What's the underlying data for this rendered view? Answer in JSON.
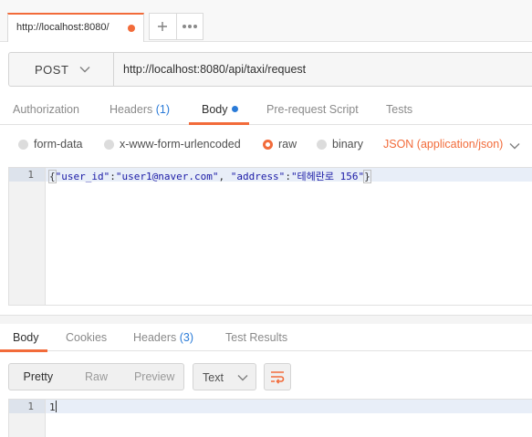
{
  "tab": {
    "title": "http://localhost:8080/",
    "unsaved_color": "#f26b3a"
  },
  "tab_actions": {
    "new_tab_icon": "plus-icon",
    "more_icon": "ellipsis-icon"
  },
  "request": {
    "method": "POST",
    "url": "http://localhost:8080/api/taxi/request"
  },
  "request_tabs": {
    "authorization": "Authorization",
    "headers": "Headers",
    "headers_count": "(1)",
    "body": "Body",
    "prerequest": "Pre-request Script",
    "tests": "Tests",
    "active": "Body"
  },
  "body_types": {
    "form_data": "form-data",
    "urlencoded": "x-www-form-urlencoded",
    "raw": "raw",
    "binary": "binary",
    "selected": "raw",
    "content_type": "JSON (application/json)"
  },
  "request_editor": {
    "line_number": "1",
    "open_brace": "{",
    "key1": "\"user_id\"",
    "colon1": ":",
    "val1": "\"user1@naver.com\"",
    "comma": ", ",
    "key2": "\"address\"",
    "colon2": ":",
    "val2": "\"테헤란로 156\"",
    "close_brace": "}"
  },
  "response_tabs": {
    "body": "Body",
    "cookies": "Cookies",
    "headers": "Headers",
    "headers_count": "(3)",
    "test_results": "Test Results",
    "active": "Body"
  },
  "response_controls": {
    "pretty": "Pretty",
    "raw": "Raw",
    "preview": "Preview",
    "format": "Text",
    "wrap_icon": "wrap-lines-icon"
  },
  "response_editor": {
    "line_number": "1",
    "content": "1"
  },
  "colors": {
    "accent": "#f26b3a",
    "link": "#2a7bd8"
  }
}
